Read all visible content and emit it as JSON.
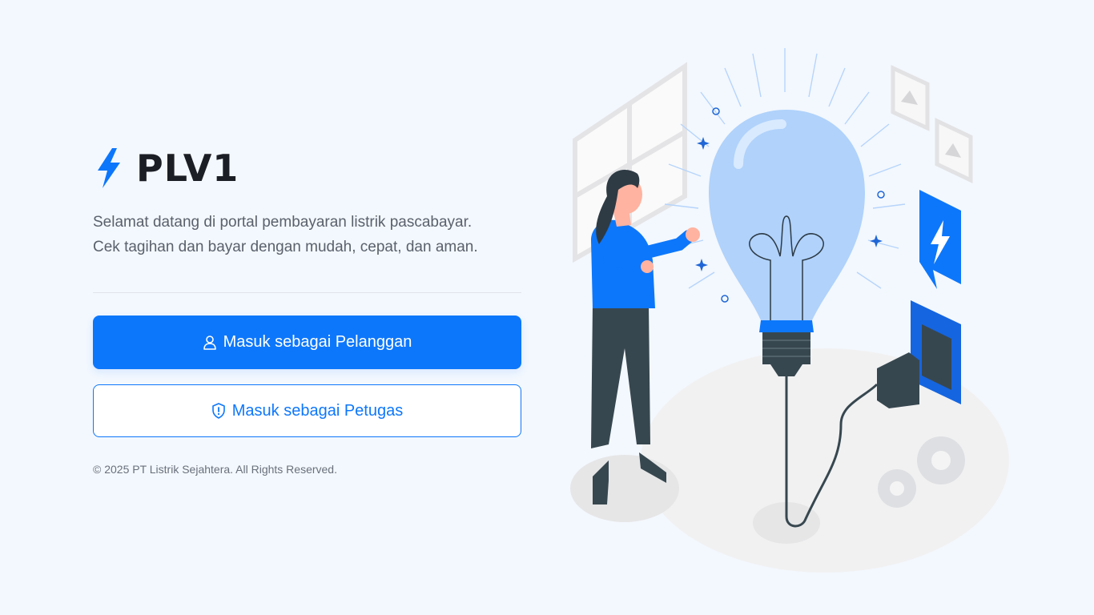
{
  "brand": {
    "name": "PLV1",
    "icon": "lightning-bolt-icon",
    "accent": "#0d77fb"
  },
  "tagline": {
    "line1": "Selamat datang di portal pembayaran listrik pascabayar.",
    "line2": "Cek tagihan dan bayar dengan mudah, cepat, dan aman."
  },
  "actions": {
    "customer_login": {
      "label": "Masuk sebagai Pelanggan",
      "icon": "user-icon"
    },
    "staff_login": {
      "label": "Masuk sebagai Petugas",
      "icon": "shield-icon"
    }
  },
  "footer": {
    "copyright": "© 2025 PT Listrik Sejahtera. All Rights Reserved."
  },
  "illustration": {
    "subject": "woman-with-light-bulb-illustration"
  },
  "colors": {
    "primary": "#0d77fb",
    "background": "#f3f8fe",
    "text": "#1b1e24",
    "muted": "#5b616b"
  }
}
